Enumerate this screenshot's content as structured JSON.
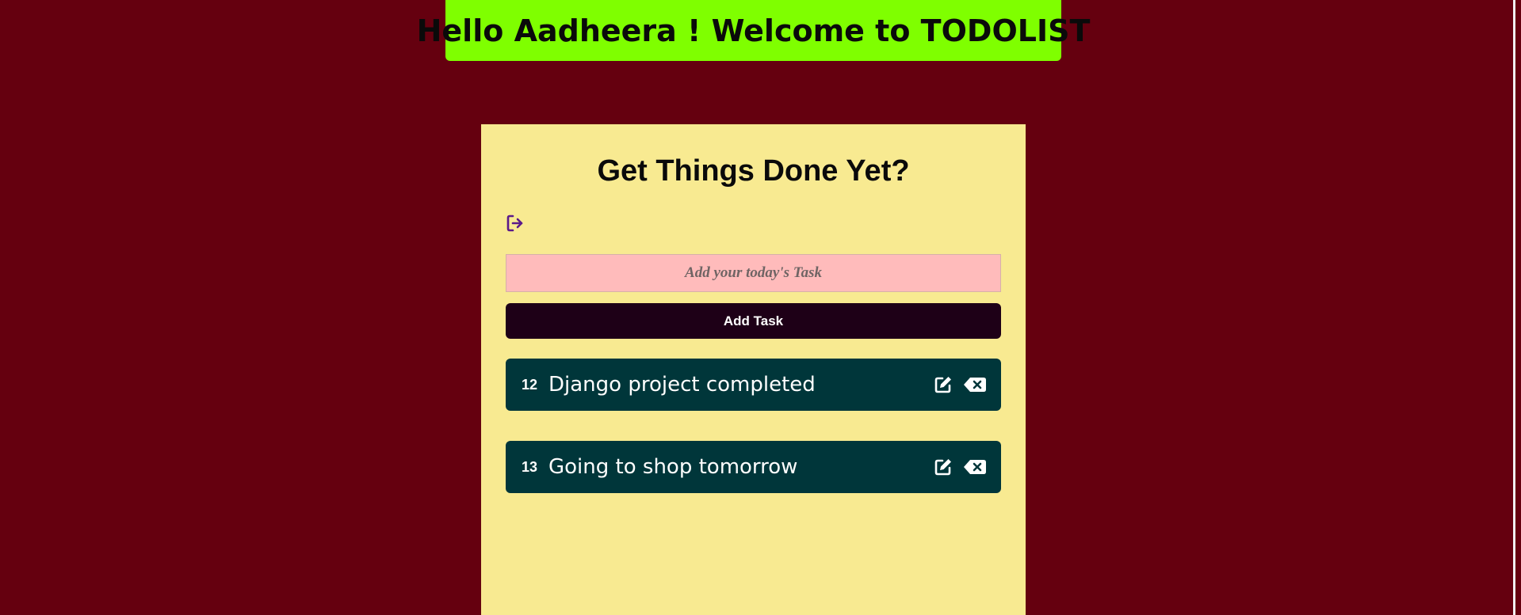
{
  "header": {
    "welcome_text": "Hello Aadheera ! Welcome to TODOLIST"
  },
  "card": {
    "title": "Get Things Done Yet?",
    "logout_icon": "logout-icon"
  },
  "form": {
    "input_value": "",
    "input_placeholder": "Add your today's Task",
    "add_button_label": "Add Task"
  },
  "tasks": [
    {
      "id": "12",
      "text": "Django project completed",
      "edit_icon": "edit-icon",
      "delete_icon": "backspace-delete-icon"
    },
    {
      "id": "13",
      "text": "Going to shop tomorrow",
      "edit_icon": "edit-icon",
      "delete_icon": "backspace-delete-icon"
    }
  ],
  "colors": {
    "page_background": "#65000f",
    "banner_background": "#7fff00",
    "card_background": "#f8ea91",
    "input_background": "#ffbbbb",
    "button_background": "#1e0017",
    "task_background": "#00363a",
    "logout_icon_color": "#5b1a8a"
  }
}
